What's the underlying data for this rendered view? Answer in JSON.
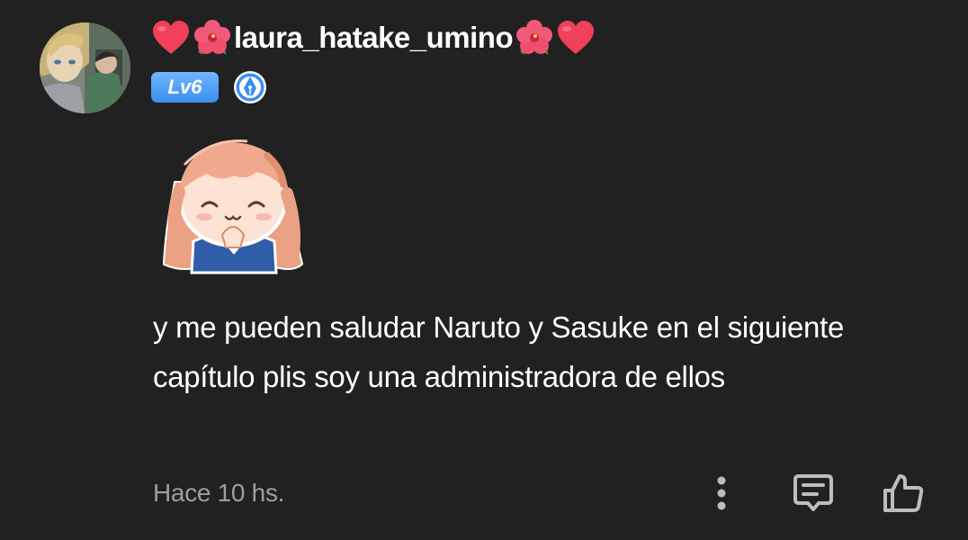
{
  "comment": {
    "author": {
      "username": "laura_hatake_umino",
      "prefix_emojis": [
        "heart-icon",
        "hibiscus-icon"
      ],
      "suffix_emojis": [
        "hibiscus-icon",
        "heart-icon"
      ],
      "level_label": "Lv6"
    },
    "sticker": "chibi-girl-sticker",
    "text": "y me pueden saludar Naruto y Sasuke en el siguiente capítulo plis soy una administradora de ellos",
    "timestamp": "Hace 10 hs.",
    "actions": [
      "more-options-icon",
      "reply-icon",
      "like-icon"
    ]
  },
  "colors": {
    "background": "#212121",
    "text_primary": "#ffffff",
    "text_secondary": "#9e9e9e",
    "level_badge": "#4a9bf5",
    "icon": "#bdbdbd"
  }
}
